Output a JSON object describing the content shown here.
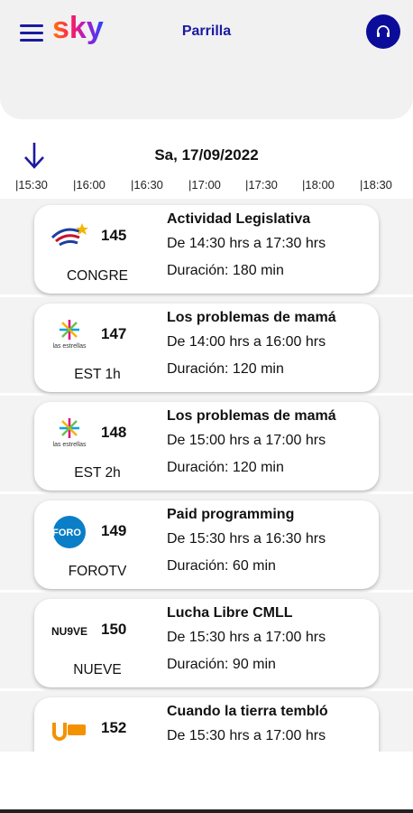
{
  "header": {
    "brand": "sky",
    "title": "Parrilla",
    "menu_icon": "hamburger-menu-icon",
    "headset_icon": "headset-icon",
    "accent_color": "#0c0c9a"
  },
  "guide": {
    "date": "Sa, 17/09/2022",
    "time_ticks": [
      "|15:30",
      "|16:00",
      "|16:30",
      "|17:00",
      "|17:30",
      "|18:00",
      "|18:30"
    ]
  },
  "channels": [
    {
      "number": "145",
      "name": "CONGRE",
      "program": "Actividad Legislativa",
      "time": "De 14:30 hrs a  17:30 hrs",
      "duration": "Duración: 180 min",
      "logo": "canal-del-congreso-logo"
    },
    {
      "number": "147",
      "name": "EST 1h",
      "program": "Los problemas de mamá",
      "time": "De 14:00 hrs a  16:00 hrs",
      "duration": "Duración: 120 min",
      "logo": "las-estrellas-logo"
    },
    {
      "number": "148",
      "name": "EST 2h",
      "program": "Los problemas de mamá",
      "time": "De 15:00 hrs a  17:00 hrs",
      "duration": "Duración: 120 min",
      "logo": "las-estrellas-logo"
    },
    {
      "number": "149",
      "name": "FOROTV",
      "program": "Paid programming",
      "time": "De 15:30 hrs a  16:30 hrs",
      "duration": "Duración: 60 min",
      "logo": "foro-tv-logo"
    },
    {
      "number": "150",
      "name": "NUEVE",
      "program": "Lucha Libre CMLL",
      "time": "De 15:30 hrs a  17:00 hrs",
      "duration": "Duración: 90 min",
      "logo": "nueve-logo"
    },
    {
      "number": "152",
      "name": "",
      "program": "Cuando la tierra tembló",
      "time": "De 15:30 hrs a  17:00 hrs",
      "duration": "",
      "logo": "unicable-logo"
    }
  ],
  "logo_text": {
    "estrellas_1": "las estrellas",
    "estrellas_2": "las estrellas",
    "foro": "FORO",
    "nueve": "NU9VE"
  }
}
